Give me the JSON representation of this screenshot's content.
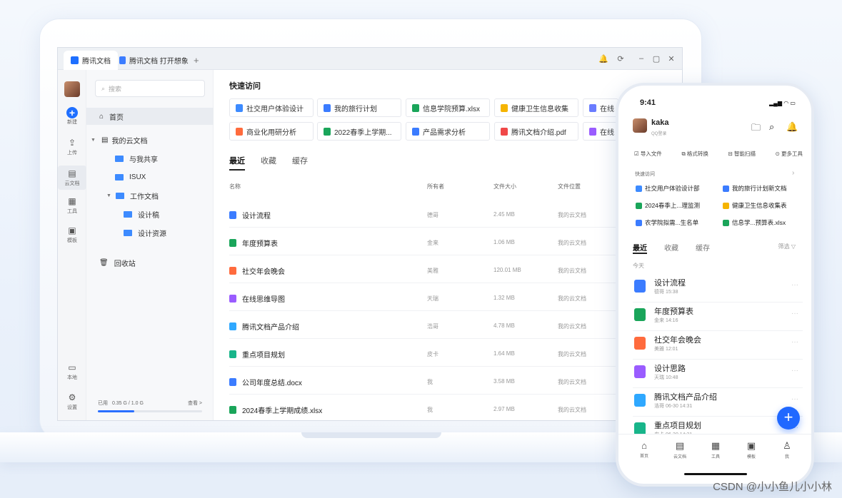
{
  "window": {
    "tabs": [
      {
        "label": "腾讯文档"
      },
      {
        "label": "腾讯文档 打开想象"
      }
    ],
    "add_tab": "+",
    "controls": [
      "🔔",
      "⟳",
      "–",
      "▢",
      "✕"
    ]
  },
  "rail": {
    "items": [
      {
        "label": "新建",
        "icon": "plus-icon"
      },
      {
        "label": "上传",
        "icon": "upload-icon"
      },
      {
        "label": "云文档",
        "icon": "cloud-doc-icon"
      },
      {
        "label": "工具",
        "icon": "tools-icon"
      },
      {
        "label": "模板",
        "icon": "template-icon"
      },
      {
        "label": "本地",
        "icon": "monitor-icon"
      },
      {
        "label": "设置",
        "icon": "gear-icon"
      }
    ]
  },
  "sidebar": {
    "search_placeholder": "搜索",
    "home": "首页",
    "my_docs": "我的云文档",
    "shared": "与我共享",
    "isux": "ISUX",
    "work_docs": "工作文档",
    "design_draft": "设计稿",
    "design_assets": "设计资源",
    "recycle": "回收站",
    "usage_label": "已用",
    "usage_value": "0.35 G / 1.0 G",
    "usage_fraction": 0.35,
    "view": "查看 >"
  },
  "main": {
    "quick_access_title": "快速访问",
    "quick_access": [
      {
        "label": "社交用户体验设计",
        "color": "#3d8bff"
      },
      {
        "label": "我的旅行计划",
        "color": "#3b7cff"
      },
      {
        "label": "信息学院预算.xlsx",
        "color": "#1aa55a"
      },
      {
        "label": "健康卫生信息收集",
        "color": "#f5b400"
      },
      {
        "label": "在线",
        "color": "#6a7cff"
      },
      {
        "label": "商业化用研分析",
        "color": "#ff6b3d"
      },
      {
        "label": "2022春季上学期...",
        "color": "#1aa55a"
      },
      {
        "label": "产品需求分析",
        "color": "#3b7cff"
      },
      {
        "label": "腾讯文档介绍.pdf",
        "color": "#f04848"
      },
      {
        "label": "在线",
        "color": "#9a5cff"
      }
    ],
    "tabs": [
      "最近",
      "收藏",
      "缓存"
    ],
    "columns": {
      "name": "名称",
      "owner": "所有者",
      "size": "文件大小",
      "location": "文件位置"
    },
    "rows": [
      {
        "name": "设计流程",
        "owner": "德哥",
        "size": "2.45 MB",
        "location": "我的云文档",
        "color": "#3b7cff"
      },
      {
        "name": "年度预算表",
        "owner": "金来",
        "size": "1.06 MB",
        "location": "我的云文档",
        "color": "#1aa55a"
      },
      {
        "name": "社交年会晚会",
        "owner": "美雅",
        "size": "120.01 MB",
        "location": "我的云文档",
        "color": "#ff6b3d"
      },
      {
        "name": "在线思维导图",
        "owner": "天瑞",
        "size": "1.32 MB",
        "location": "我的云文档",
        "color": "#9a5cff"
      },
      {
        "name": "腾讯文档产品介绍",
        "owner": "浩哥",
        "size": "4.78 MB",
        "location": "我的云文档",
        "color": "#2fa8ff"
      },
      {
        "name": "重点项目规划",
        "owner": "皮卡",
        "size": "1.64 MB",
        "location": "我的云文档",
        "color": "#18b58a"
      },
      {
        "name": "公司年度总结.docx",
        "owner": "我",
        "size": "3.58 MB",
        "location": "我的云文档",
        "color": "#3b7cff"
      },
      {
        "name": "2024春季上学期成绩.xlsx",
        "owner": "我",
        "size": "2.97 MB",
        "location": "我的云文档",
        "color": "#1aa55a"
      }
    ]
  },
  "phone": {
    "time": "9:41",
    "status": "▂▄▆ ◠ ▭",
    "user": "kaka",
    "sub": "QQ登录",
    "tools": [
      "导入文件",
      "格式转换",
      "智能扫描",
      "更多工具"
    ],
    "quick_access_title": "快速访问",
    "quick_access_more": "›",
    "quick": [
      {
        "label": "社交用户体验设计部",
        "color": "#3d8bff"
      },
      {
        "label": "我的旅行计划新文档",
        "color": "#3b7cff"
      },
      {
        "label": "2024春季上...理监测",
        "color": "#1aa55a"
      },
      {
        "label": "健康卫生信息收集表",
        "color": "#f5b400"
      },
      {
        "label": "农学院拟需...生名单",
        "color": "#3b7cff"
      },
      {
        "label": "信息学...预算表.xlsx",
        "color": "#1aa55a"
      }
    ],
    "tabs": [
      "最近",
      "收藏",
      "缓存"
    ],
    "filter": "筛选 ▽",
    "today": "今天",
    "rows": [
      {
        "title": "设计流程",
        "sub": "德哥  15:38",
        "color": "#3b7cff"
      },
      {
        "title": "年度预算表",
        "sub": "金来  14:16",
        "color": "#1aa55a"
      },
      {
        "title": "社交年会晚会",
        "sub": "美雅  12:01",
        "color": "#ff6b3d"
      },
      {
        "title": "设计思路",
        "sub": "天瑞  10:48",
        "color": "#9a5cff"
      },
      {
        "title": "腾讯文档产品介绍",
        "sub": "浩哥  06-30 14:31",
        "color": "#2fa8ff"
      },
      {
        "title": "重点项目规划",
        "sub": "皮卡  06-30 14:31",
        "color": "#18b58a"
      }
    ],
    "more": "···",
    "fab": "+",
    "bottom_nav": [
      "首页",
      "云文档",
      "工具",
      "模板",
      "我"
    ]
  },
  "watermark": "CSDN @小小鱼儿小小林"
}
